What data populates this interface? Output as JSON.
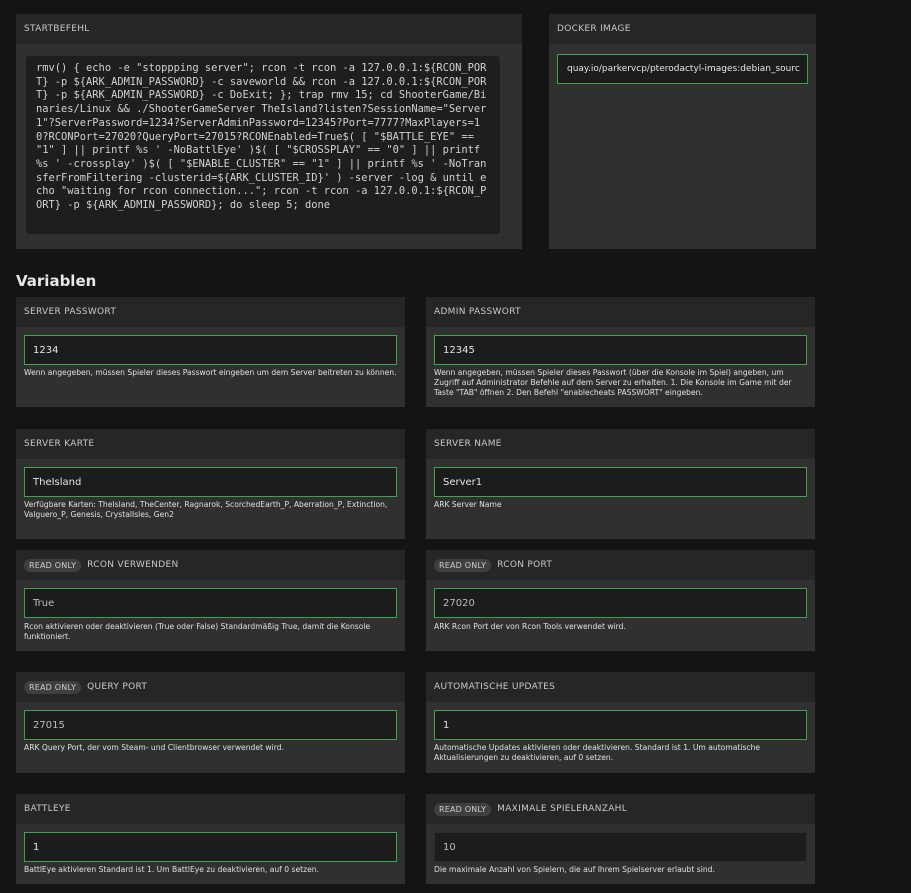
{
  "startup": {
    "header": "STARTBEFEHL",
    "command": "rmv() { echo -e \"stoppping server\"; rcon -t rcon -a 127.0.0.1:${RCON_PORT} -p ${ARK_ADMIN_PASSWORD} -c saveworld && rcon -a 127.0.0.1:${RCON_PORT} -p ${ARK_ADMIN_PASSWORD} -c DoExit; }; trap rmv 15; cd ShooterGame/Binaries/Linux && ./ShooterGameServer TheIsland?listen?SessionName=\"Server1\"?ServerPassword=1234?ServerAdminPassword=12345?Port=7777?MaxPlayers=10?RCONPort=27020?QueryPort=27015?RCONEnabled=True$( [ \"$BATTLE_EYE\" == \"1\" ] || printf %s ' -NoBattlEye' )$( [ \"$CROSSPLAY\" == \"0\" ] || printf %s ' -crossplay' )$( [ \"$ENABLE_CLUSTER\" == \"1\" ] || printf %s ' -NoTransferFromFiltering -clusterid=${ARK_CLUSTER_ID}' ) -server -log & until echo \"waiting for rcon connection...\"; rcon -t rcon -a 127.0.0.1:${RCON_PORT} -p ${ARK_ADMIN_PASSWORD}; do sleep 5; done"
  },
  "docker": {
    "header": "DOCKER IMAGE",
    "value": "quay.io/parkervcp/pterodactyl-images:debian_sourc"
  },
  "variables_title": "Variablen",
  "read_only_badge": "READ ONLY",
  "variables": [
    {
      "label": "SERVER PASSWORT",
      "value": "1234",
      "help": "Wenn angegeben, müssen Spieler dieses Passwort eingeben um dem Server beitreten zu können."
    },
    {
      "label": "ADMIN PASSWORT",
      "value": "12345",
      "help": "Wenn angegeben, müssen Spieler dieses Passwort (über die Konsole im Spiel) angeben, um Zugriff auf Administrator Befehle auf dem Server zu erhalten. 1. Die Konsole im Game mit der Taste \"TAB\" öffnen 2. Den Befehl \"enablecheats PASSWORT\" eingeben."
    },
    {
      "label": "SERVER KARTE",
      "value": "TheIsland",
      "help": "Verfügbare Karten: TheIsland, TheCenter, Ragnarok, ScorchedEarth_P, Aberration_P, Extinction, Valguero_P, Genesis, CrystalIsles, Gen2"
    },
    {
      "label": "SERVER NAME",
      "value": "Server1",
      "help": "ARK Server Name"
    },
    {
      "label": "RCON VERWENDEN",
      "value": "True",
      "help": "Rcon aktivieren oder deaktivieren (True oder False) Standardmäßig True, damit die Konsole funktioniert."
    },
    {
      "label": "RCON PORT",
      "value": "27020",
      "help": "ARK Rcon Port der von Rcon Tools verwendet wird."
    },
    {
      "label": "QUERY PORT",
      "value": "27015",
      "help": "ARK Query Port, der vom Steam- und Clientbrowser verwendet wird."
    },
    {
      "label": "AUTOMATISCHE UPDATES",
      "value": "1",
      "help": "Automatische Updates aktivieren oder deaktivieren. Standard ist 1. Um automatische Aktualisierungen zu deaktivieren, auf 0 setzen."
    },
    {
      "label": "BATTLEYE",
      "value": "1",
      "help": "BattlEye aktivieren Standard ist 1. Um BattlEye zu deaktivieren, auf 0 setzen."
    },
    {
      "label": "MAXIMALE SPIELERANZAHL",
      "value": "10",
      "help": "Die maximale Anzahl von Spielern, die auf Ihrem Spielserver erlaubt sind."
    }
  ],
  "colors": {
    "field_border": "#3fa34d",
    "panel": "#262626",
    "panel_body": "#303030"
  }
}
